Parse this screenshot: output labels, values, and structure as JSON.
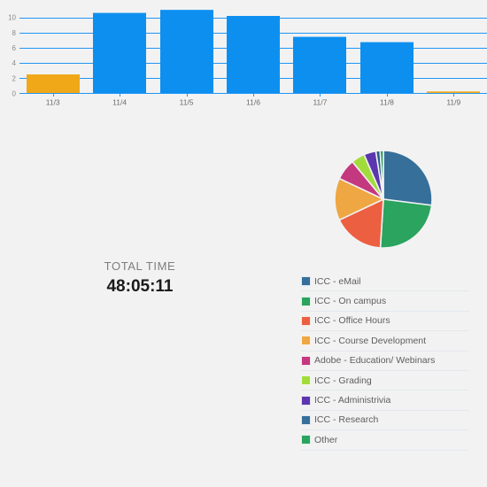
{
  "colors": {
    "background": "#f2f2f2",
    "bar_primary": "#0d8ff0",
    "bar_highlight": "#f0a818",
    "gridline": "#2196f3",
    "axis_text": "#8a8a8a",
    "category_text": "#6b6b6b",
    "legend_text": "#5e5e5e",
    "legend_separator": "#e4e8ee",
    "total_label_text": "#7e7e7e",
    "total_value_text": "#1a1a1a"
  },
  "total_time": {
    "label": "TOTAL TIME",
    "value": "48:05:11"
  },
  "legend": {
    "items": [
      {
        "label": "ICC - eMail",
        "color": "#366f9a"
      },
      {
        "label": "ICC - On campus",
        "color": "#2aa45e"
      },
      {
        "label": "ICC - Office Hours",
        "color": "#ec5f41"
      },
      {
        "label": "ICC - Course Development",
        "color": "#eea743"
      },
      {
        "label": "Adobe - Education/ Webinars",
        "color": "#c4387f"
      },
      {
        "label": "ICC - Grading",
        "color": "#a2dc3c"
      },
      {
        "label": "ICC - Administrivia",
        "color": "#5b36ae"
      },
      {
        "label": "ICC - Research",
        "color": "#366f9a"
      },
      {
        "label": "Other",
        "color": "#2aa45e"
      }
    ]
  },
  "chart_data": [
    {
      "type": "bar",
      "title": "",
      "xlabel": "",
      "ylabel": "",
      "categories": [
        "11/3",
        "11/4",
        "11/5",
        "11/6",
        "11/7",
        "11/8",
        "11/9"
      ],
      "values": [
        2.5,
        10.6,
        11.0,
        10.2,
        7.45,
        6.75,
        0.15
      ],
      "bar_colors": [
        "#f0a818",
        "#0d8ff0",
        "#0d8ff0",
        "#0d8ff0",
        "#0d8ff0",
        "#0d8ff0",
        "#f0a818"
      ],
      "ylim": [
        0,
        11.6
      ],
      "yticks": [
        0,
        2,
        4,
        6,
        8,
        10
      ],
      "ytick_labels": [
        "0",
        "2",
        "4",
        "6",
        "8",
        "10"
      ],
      "grid": true,
      "legend": "none"
    },
    {
      "type": "pie",
      "title": "",
      "labels": [
        "ICC - eMail",
        "ICC - On campus",
        "ICC - Office Hours",
        "ICC - Course Development",
        "Adobe - Education/ Webinars",
        "ICC - Grading",
        "ICC - Administrivia",
        "ICC - Research",
        "Other"
      ],
      "values": [
        27.0,
        24.0,
        17.0,
        14.0,
        7.0,
        4.5,
        4.0,
        1.4,
        1.1
      ],
      "colors": [
        "#366f9a",
        "#2aa45e",
        "#ec5f41",
        "#eea743",
        "#c4387f",
        "#a2dc3c",
        "#5b36ae",
        "#2a5d87",
        "#1e9c58"
      ],
      "start_angle_deg": 0,
      "direction": "clockwise",
      "legend": "right"
    }
  ]
}
